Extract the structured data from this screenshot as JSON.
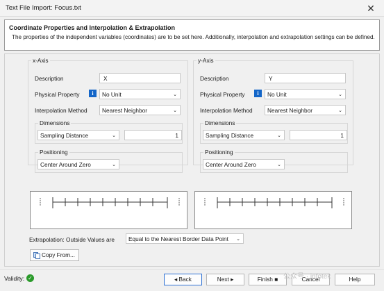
{
  "window": {
    "title": "Text File Import: Focus.txt",
    "close_symbol": "✕"
  },
  "header": {
    "title": "Coordinate Properties and Interpolation & Extrapolation",
    "description": "The properties of the independent variables (coordinates) are to be set here. Additionally, interpolation and extrapolation settings can be defined."
  },
  "x_axis": {
    "legend": "x-Axis",
    "description_label": "Description",
    "description_value": "X",
    "physical_property_label": "Physical Property",
    "physical_property_value": "No Unit",
    "interpolation_label": "Interpolation Method",
    "interpolation_value": "Nearest Neighbor",
    "dimensions_legend": "Dimensions",
    "dimension_mode": "Sampling Distance",
    "dimension_value": "1",
    "positioning_legend": "Positioning",
    "positioning_value": "Center Around Zero"
  },
  "y_axis": {
    "legend": "y-Axis",
    "description_label": "Description",
    "description_value": "Y",
    "physical_property_label": "Physical Property",
    "physical_property_value": "No Unit",
    "interpolation_label": "Interpolation Method",
    "interpolation_value": "Nearest Neighbor",
    "dimensions_legend": "Dimensions",
    "dimension_mode": "Sampling Distance",
    "dimension_value": "1",
    "positioning_legend": "Positioning",
    "positioning_value": "Center Around Zero"
  },
  "info_symbol": "i",
  "dropdown_arrow": "⌄",
  "extrapolation": {
    "label": "Extrapolation: Outside Values are",
    "value": "Equal to the Nearest Border Data Point"
  },
  "copy_from_label": "Copy From...",
  "footer": {
    "validity_label": "Validity:",
    "validity_symbol": "✓",
    "back_label": "◂ Back",
    "next_label": "Next ▸",
    "finish_label": "Finish ■",
    "cancel_label": "Cancel",
    "help_label": "Help",
    "watermark": "公众号 · infotek"
  },
  "colors": {
    "accent": "#2c70d4",
    "info": "#1466c8",
    "valid": "#2a9a2a"
  }
}
